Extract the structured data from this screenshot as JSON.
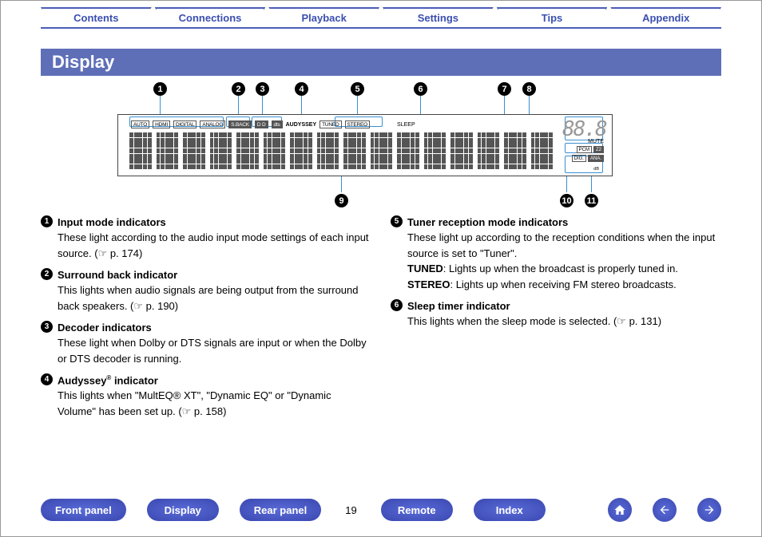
{
  "tabs": [
    "Contents",
    "Connections",
    "Playback",
    "Settings",
    "Tips",
    "Appendix"
  ],
  "title": "Display",
  "callouts_top": [
    "1",
    "2",
    "3",
    "4",
    "5",
    "6",
    "7",
    "8"
  ],
  "callouts_bottom": [
    "9",
    "10",
    "11"
  ],
  "display_indicators": {
    "input_modes": [
      "AUTO",
      "HDMI",
      "DIGITAL",
      "ANALOG"
    ],
    "sback": "S.BACK",
    "decoder1": "D D",
    "decoder2": "dts",
    "audyssey": "AUDYSSEY",
    "tuner": [
      "TUNED",
      "STEREO"
    ],
    "sleep": "SLEEP",
    "mute": "MUTE",
    "seg": "88.8",
    "db": "dB",
    "small": [
      "PCM",
      "Z2",
      "DIG.",
      "ANA."
    ]
  },
  "left_items": [
    {
      "n": "1",
      "title": "Input mode indicators",
      "body": "These light according to the audio input mode settings of each input source.  (☞ p. 174)"
    },
    {
      "n": "2",
      "title": "Surround back indicator",
      "body": "This lights when audio signals are being output from the surround back speakers.  (☞ p. 190)"
    },
    {
      "n": "3",
      "title": "Decoder indicators",
      "body": "These light when Dolby or DTS signals are input or when the Dolby or DTS decoder is running."
    },
    {
      "n": "4",
      "title_html": "Audyssey® indicator",
      "body": "This lights when \"MultEQ® XT\", \"Dynamic EQ\" or \"Dynamic Volume\" has been set up.  (☞ p. 158)"
    }
  ],
  "right_items": [
    {
      "n": "5",
      "title": "Tuner reception mode indicators",
      "lines": [
        "These light up according to the reception conditions when the input source is set to \"Tuner\".",
        "<b>TUNED</b>: Lights up when the broadcast is properly tuned in.",
        "<b>STEREO</b>: Lights up when receiving FM stereo broadcasts."
      ]
    },
    {
      "n": "6",
      "title": "Sleep timer indicator",
      "body": "This lights when the sleep mode is selected.  (☞ p. 131)"
    }
  ],
  "bottom_nav": {
    "pills": [
      "Front panel",
      "Display",
      "Rear panel"
    ],
    "page": "19",
    "pills2": [
      "Remote",
      "Index"
    ]
  }
}
